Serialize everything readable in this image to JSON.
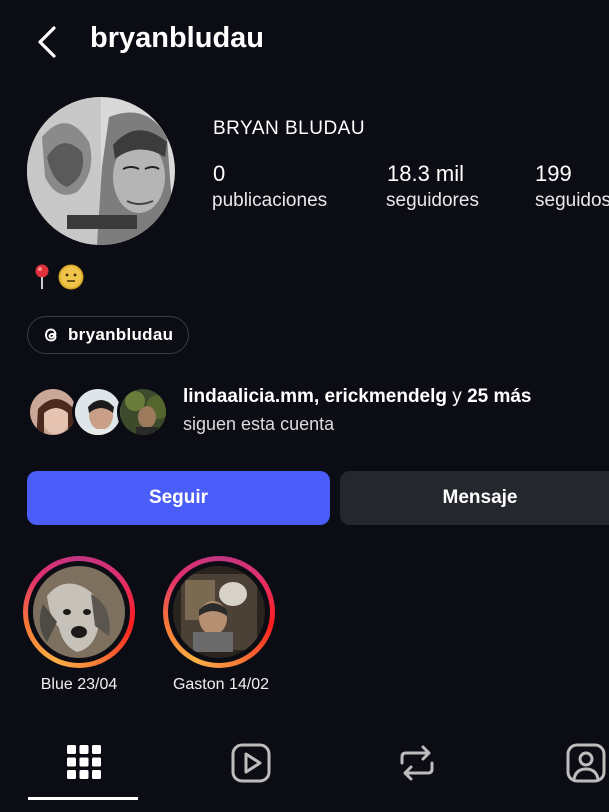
{
  "header": {
    "username": "bryanbludau"
  },
  "profile": {
    "display_name": "BRYAN BLUDAU",
    "stats": [
      {
        "value": "0",
        "label": "publicaciones"
      },
      {
        "value": "18.3 mil",
        "label": "seguidores"
      },
      {
        "value": "199",
        "label": "seguidos"
      }
    ],
    "threads_handle": "bryanbludau"
  },
  "mutual": {
    "names": "lindaalicia.mm, erickmendelg",
    "connector": " y ",
    "more": "25 más",
    "line2": "siguen esta cuenta"
  },
  "buttons": {
    "follow": "Seguir",
    "message": "Mensaje"
  },
  "highlights": [
    {
      "label": "Blue 23/04"
    },
    {
      "label": "Gaston 14/02"
    }
  ],
  "tabs": [
    "grid-icon",
    "reels-icon",
    "reposts-icon",
    "tagged-icon"
  ],
  "colors": {
    "background": "#0c0d14",
    "follow_button": "#4a5df9",
    "message_button": "#25272e"
  }
}
